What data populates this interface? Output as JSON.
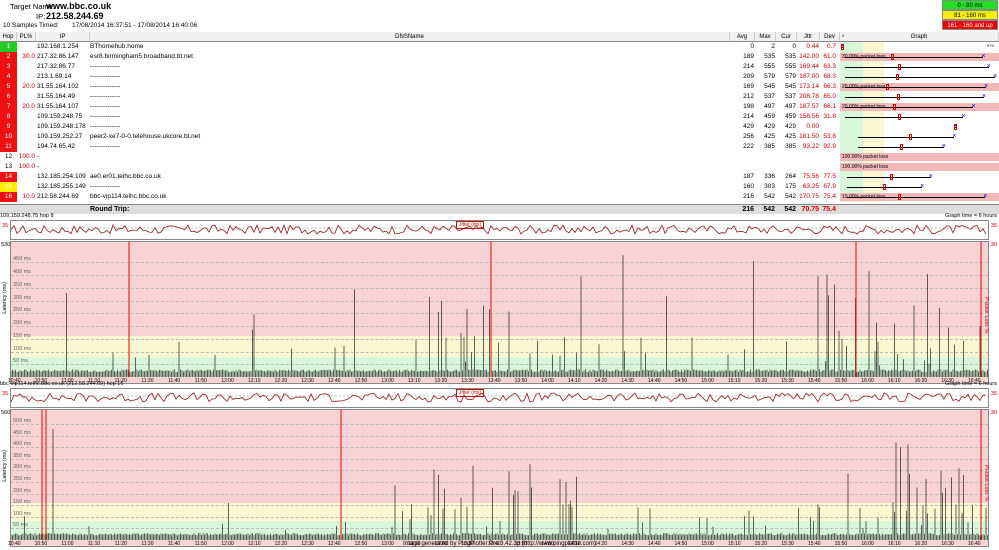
{
  "header": {
    "target_label": "Target Name:",
    "target": "www.bbc.co.uk",
    "ip_label": "IP:",
    "ip": "212.58.244.69",
    "samples": "10 Samples Timed:",
    "range": "17/08/2014 16:37:51 - 17/08/2014 16:40:06"
  },
  "legend": [
    {
      "label": "0 - 80 ms",
      "color": "#22dd22"
    },
    {
      "label": "81 - 160 ms",
      "color": "#ffee00"
    },
    {
      "label": "161 - 160 and up",
      "color": "#ee0000"
    }
  ],
  "columns": {
    "hop": "Hop",
    "pl": "PL%",
    "ip": "IP",
    "dns": "DNSName",
    "avg": "Avg",
    "max": "Max",
    "cur": "Cur",
    "jttr": "Jttr",
    "dev": "Dev",
    "graph": "Graph"
  },
  "graph_scale": {
    "left": "0",
    "right": "579"
  },
  "hops": [
    {
      "hop": "1",
      "pl": "",
      "ip": "192.168.1.254",
      "dns": "BThomehub.home",
      "avg": "0",
      "max": "2",
      "cur": "0",
      "jttr": "0.44",
      "dev": "0.7",
      "color": "#22cc22",
      "loss": "",
      "gmin": 0,
      "gmax": 2,
      "gavg": 0
    },
    {
      "hop": "2",
      "pl": "30.0",
      "ip": "217.32.86.147",
      "dns": "esr8.birmingham5.broadband.bt.net",
      "avg": "189",
      "max": "535",
      "cur": "535",
      "jttr": "142.00",
      "dev": "61.0",
      "color": "#ee1111",
      "loss": "30.00% packet loss",
      "gmin": 10,
      "gmax": 535,
      "gavg": 189
    },
    {
      "hop": "3",
      "pl": "",
      "ip": "217.32.86.77",
      "dns": "--------------",
      "avg": "214",
      "max": "555",
      "cur": "555",
      "jttr": "169.44",
      "dev": "63.3",
      "color": "#ee1111",
      "loss": "",
      "gmin": 10,
      "gmax": 555,
      "gavg": 214
    },
    {
      "hop": "4",
      "pl": "",
      "ip": "213.1.69.14",
      "dns": "--------------",
      "avg": "209",
      "max": "579",
      "cur": "579",
      "jttr": "187.00",
      "dev": "68.3",
      "color": "#ee1111",
      "loss": "",
      "gmin": 10,
      "gmax": 579,
      "gavg": 209
    },
    {
      "hop": "5",
      "pl": "20.0",
      "ip": "31.55.164.102",
      "dns": "--------------",
      "avg": "169",
      "max": "545",
      "cur": "545",
      "jttr": "173.14",
      "dev": "66.3",
      "color": "#ee1111",
      "loss": "20.00% packet loss",
      "gmin": 10,
      "gmax": 545,
      "gavg": 169
    },
    {
      "hop": "6",
      "pl": "",
      "ip": "31.55.164.49",
      "dns": "--------------",
      "avg": "212",
      "max": "537",
      "cur": "537",
      "jttr": "208.78",
      "dev": "65.0",
      "color": "#ee1111",
      "loss": "",
      "gmin": 10,
      "gmax": 537,
      "gavg": 212
    },
    {
      "hop": "7",
      "pl": "20.0",
      "ip": "31.55.164.107",
      "dns": "--------------",
      "avg": "198",
      "max": "497",
      "cur": "497",
      "jttr": "187.57",
      "dev": "66.1",
      "color": "#ee1111",
      "loss": "20.00% packet loss",
      "gmin": 10,
      "gmax": 497,
      "gavg": 198
    },
    {
      "hop": "8",
      "pl": "",
      "ip": "109.159.248.75",
      "dns": "--------------",
      "avg": "214",
      "max": "459",
      "cur": "459",
      "jttr": "158.56",
      "dev": "31.8",
      "color": "#ee1111",
      "loss": "",
      "gmin": 10,
      "gmax": 459,
      "gavg": 214
    },
    {
      "hop": "9",
      "pl": "",
      "ip": "109.159.248.178",
      "dns": "--------------",
      "avg": "429",
      "max": "429",
      "cur": "429",
      "jttr": "0.00",
      "dev": "",
      "color": "#ee1111",
      "loss": "",
      "gmin": 429,
      "gmax": 429,
      "gavg": 429
    },
    {
      "hop": "10",
      "pl": "",
      "ip": "109.159.252.27",
      "dns": "peer2-xe7-0-0.telehouse.ukcore.bt.net",
      "avg": "256",
      "max": "425",
      "cur": "425",
      "jttr": "181.50",
      "dev": "53.8",
      "color": "#ee1111",
      "loss": "",
      "gmin": 60,
      "gmax": 425,
      "gavg": 256
    },
    {
      "hop": "11",
      "pl": "",
      "ip": "194.74.65.42",
      "dns": "--------------",
      "avg": "222",
      "max": "385",
      "cur": "385",
      "jttr": "93.22",
      "dev": "92.9",
      "color": "#ee1111",
      "loss": "",
      "gmin": 60,
      "gmax": 385,
      "gavg": 222
    },
    {
      "hop": "12",
      "pl": "100.0",
      "ip": "-",
      "dns": "",
      "avg": "",
      "max": "",
      "cur": "",
      "jttr": "",
      "dev": "",
      "color": "#ffffff",
      "loss": "100.00% packet loss",
      "gmin": null,
      "gmax": null,
      "gavg": null
    },
    {
      "hop": "13",
      "pl": "100.0",
      "ip": "-",
      "dns": "",
      "avg": "",
      "max": "",
      "cur": "",
      "jttr": "",
      "dev": "",
      "color": "#ffffff",
      "loss": "100.00% packet loss",
      "gmin": null,
      "gmax": null,
      "gavg": null
    },
    {
      "hop": "14",
      "pl": "",
      "ip": "132.185.254.109",
      "dns": "ae0.er01.telhc.bbc.co.uk",
      "avg": "187",
      "max": "336",
      "cur": "264",
      "jttr": "75.56",
      "dev": "77.5",
      "color": "#ee1111",
      "loss": "",
      "gmin": 20,
      "gmax": 336,
      "gavg": 187
    },
    {
      "hop": "15",
      "pl": "",
      "ip": "132.185.255.149",
      "dns": "--------------",
      "avg": "160",
      "max": "303",
      "cur": "175",
      "jttr": "63.25",
      "dev": "67.9",
      "color": "#ffee00",
      "loss": "",
      "gmin": 20,
      "gmax": 303,
      "gavg": 160
    },
    {
      "hop": "16",
      "pl": "10.0",
      "ip": "212.58.244.69",
      "dns": "bbc-vip114.telhc.bbc.co.uk",
      "avg": "216",
      "max": "542",
      "cur": "542",
      "jttr": "170.75",
      "dev": "75.4",
      "color": "#ee1111",
      "loss": "10.00% packet loss",
      "gmin": 20,
      "gmax": 542,
      "gavg": 216
    }
  ],
  "round_trip": {
    "label": "Round Trip:",
    "avg": "216",
    "max": "542",
    "cur": "542",
    "jttr": "70.75",
    "dev": "75.4"
  },
  "panels": [
    {
      "title": "109.159.248.75 hop 8",
      "time": "Graph time = 6 hours",
      "jitter_label": "Jitter (ms)",
      "jitter_max": "35",
      "jitter_right": "35",
      "ymax_label": "530",
      "right_label": "30",
      "axis": "Latency (ms)",
      "loss_axis": "Packet Loss %",
      "ticks": [
        "450 ms",
        "400 ms",
        "350 ms",
        "300 ms",
        "250 ms",
        "200 ms",
        "150 ms",
        "100 ms",
        "50 ms"
      ]
    },
    {
      "title": "bbc-vip114.telhc.bbc.co.uk (212.58.244.69) hop 16",
      "time": "Graph time = 6 hours",
      "jitter_label": "Jitter (ms)",
      "jitter_max": "35",
      "jitter_right": "35",
      "ymax_label": "560",
      "right_label": "30",
      "axis": "Latency (ms)",
      "loss_axis": "Packet Loss %",
      "ticks": [
        "500 ms",
        "450 ms",
        "400 ms",
        "350 ms",
        "300 ms",
        "250 ms",
        "200 ms",
        "150 ms",
        "100 ms",
        "50 ms"
      ]
    }
  ],
  "xticks": [
    "10:40",
    "10:50",
    "11:00",
    "11:10",
    "11:20",
    "11:30",
    "11:40",
    "11:50",
    "12:00",
    "12:10",
    "12:20",
    "12:30",
    "12:40",
    "12:50",
    "13:00",
    "13:10",
    "13:20",
    "13:30",
    "13:40",
    "13:50",
    "14:00",
    "14:10",
    "14:20",
    "14:30",
    "14:40",
    "14:50",
    "15:00",
    "15:10",
    "15:20",
    "15:30",
    "15:40",
    "15:50",
    "16:00",
    "16:10",
    "16:20",
    "16:30",
    "16:40"
  ],
  "footer": "Image generated by PingPlotter Pro 3.42.3p (http://www.pingplotter.com)"
}
